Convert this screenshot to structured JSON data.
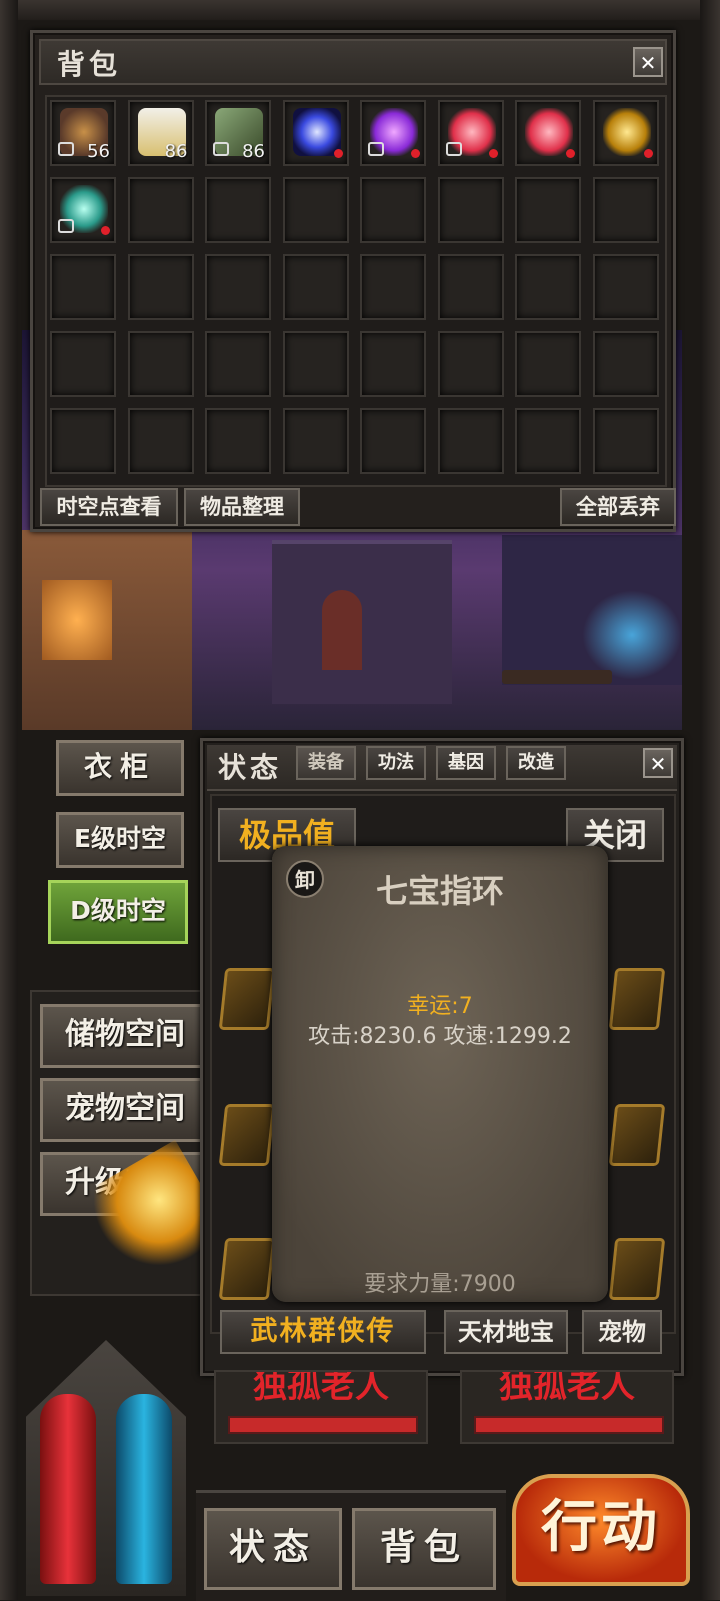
{
  "bag": {
    "title": "背包",
    "close": "✕",
    "items": [
      {
        "icon": "scroll-icon",
        "count": "56",
        "locked": true,
        "dot": false
      },
      {
        "icon": "package-icon",
        "count": "86",
        "locked": false,
        "dot": false
      },
      {
        "icon": "bottle-icon",
        "count": "86",
        "locked": true,
        "dot": false
      },
      {
        "icon": "vortex-icon",
        "count": "",
        "locked": false,
        "dot": true
      },
      {
        "icon": "purple-crystal-icon",
        "count": "",
        "locked": true,
        "dot": true
      },
      {
        "icon": "red-crystal-icon",
        "count": "",
        "locked": true,
        "dot": true
      },
      {
        "icon": "red-crystal-icon",
        "count": "",
        "locked": false,
        "dot": true
      },
      {
        "icon": "golden-ring-icon",
        "count": "",
        "locked": false,
        "dot": true
      },
      {
        "icon": "jade-ring-icon",
        "count": "",
        "locked": true,
        "dot": true
      }
    ],
    "buttons": {
      "spacetime": "时空点查看",
      "sort": "物品整理",
      "discard_all": "全部丢弃"
    }
  },
  "left_menu": {
    "wardrobe": "衣柜",
    "e_space": "E级时空",
    "d_space": "D级时空",
    "storage": "储物空间",
    "pet_space": "宠物空间",
    "upgrade": "升级空间"
  },
  "status": {
    "title": "状态",
    "tabs": [
      "装备",
      "功法",
      "基因",
      "改造"
    ],
    "close": "✕",
    "quality": "极品值",
    "close_button": "关闭",
    "bottom_tabs": [
      "武林群侠传",
      "天材地宝",
      "宠物"
    ]
  },
  "tooltip": {
    "unequip": "卸",
    "name": "七宝指环",
    "luck": "幸运:7",
    "stats": "攻击:8230.6 攻速:1299.2",
    "requirement": "要求力量:7900"
  },
  "npc": {
    "left": "独孤老人",
    "right": "独孤老人"
  },
  "bottom_bar": {
    "status": "状态",
    "bag": "背包",
    "action": "行动"
  },
  "colors": {
    "gold": "#f1b020",
    "hp": "#d82a2a",
    "mp": "#1fa3c8"
  }
}
